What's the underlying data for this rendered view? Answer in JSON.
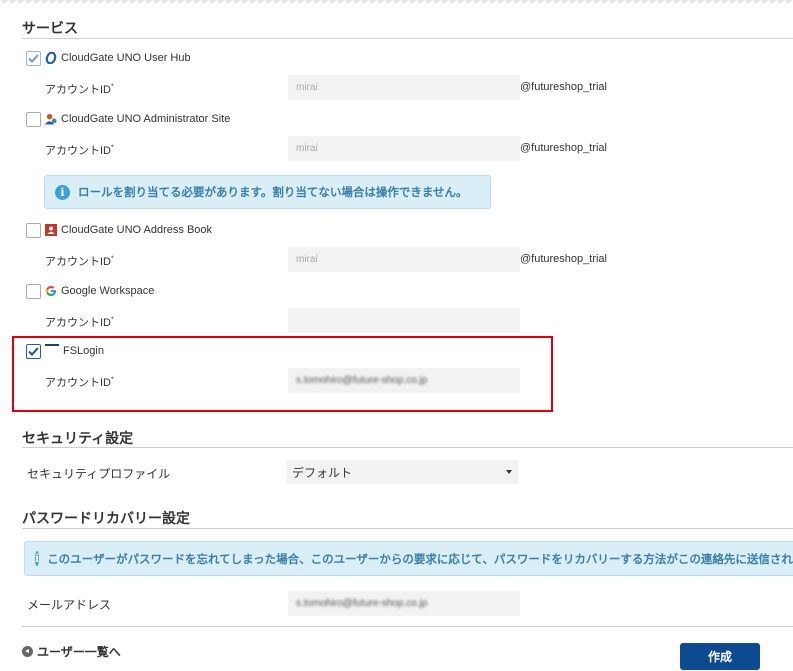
{
  "services_section": {
    "title": "サービス",
    "items": [
      {
        "name": "CloudGate UNO User Hub",
        "checked": true,
        "icon": "cloudgate-userhub-icon",
        "account_label": "アカウントID",
        "account_value": "mirai",
        "suffix": "@futureshop_trial"
      },
      {
        "name": "CloudGate UNO Administrator Site",
        "checked": false,
        "icon": "admin-user-icon",
        "account_label": "アカウントID",
        "account_value": "mirai",
        "suffix": "@futureshop_trial"
      },
      {
        "name": "CloudGate UNO Address Book",
        "checked": false,
        "icon": "address-book-icon",
        "account_label": "アカウントID",
        "account_value": "mirai",
        "suffix": "@futureshop_trial"
      },
      {
        "name": "Google Workspace",
        "checked": false,
        "icon": "google-icon",
        "account_label": "アカウントID",
        "account_value": "",
        "suffix": ""
      },
      {
        "name": "FSLogin",
        "checked": true,
        "icon": "fslogin-icon",
        "account_label": "アカウントID",
        "account_value": "s.tomohiro@future-shop.co.jp",
        "suffix": ""
      }
    ],
    "role_notice": "ロールを割り当てる必要があります。割り当てない場合は操作できません。"
  },
  "security_section": {
    "title": "セキュリティ設定",
    "profile_label": "セキュリティプロファイル",
    "profile_value": "デフォルト"
  },
  "password_section": {
    "title": "パスワードリカバリー設定",
    "notice": "このユーザーがパスワードを忘れてしまった場合、このユーザーからの要求に応じて、パスワードをリカバリーする方法がこの連絡先に送信されます",
    "email_label": "メールアドレス",
    "email_value": "s.tomohiro@future-shop.co.jp"
  },
  "footer": {
    "back_link": "ユーザー一覧へ",
    "create_button": "作成"
  },
  "colors": {
    "highlight_border": "#e0000b",
    "primary_button": "#0d4a8f",
    "info_bg": "#d9eef7",
    "info_text": "#3a7fa8"
  }
}
